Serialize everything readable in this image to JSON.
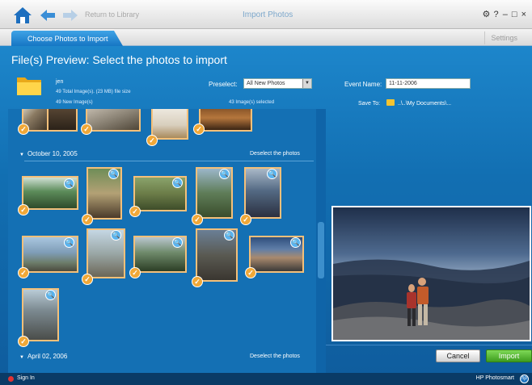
{
  "titlebar": {
    "return_label": "Return to Library",
    "title": "Import Photos",
    "controls": "⚙ ? – □ ×"
  },
  "tabs": {
    "active": "Choose Photos to Import",
    "settings": "Settings"
  },
  "page_title": "File(s) Preview: Select the photos to import",
  "source": {
    "name": "jen",
    "total": "49 Total Image(s). (23 MB) file size",
    "new_count": "49 New Image(s)",
    "selected": "43 Image(s) selected"
  },
  "preselect": {
    "label": "Preselect:",
    "value": "All New Photos"
  },
  "event": {
    "label": "Event Name:",
    "value": "11-11-2006"
  },
  "save_to": {
    "label": "Save To:",
    "path": "..\\..\\My Documents\\..."
  },
  "groups": [
    {
      "date": "October 10, 2005",
      "deselect": "Deselect the photos"
    },
    {
      "date": "April 02, 2006",
      "deselect": "Deselect the photos"
    }
  ],
  "icons": {
    "check": "✓",
    "zoom": "🔍"
  },
  "buttons": {
    "cancel": "Cancel",
    "import": "Import"
  },
  "status": {
    "signin": "Sign In",
    "brand": "HP Photosmart",
    "logo": "hp"
  },
  "colors": {
    "accent": "#1676c4",
    "selection_border": "#f4c07a",
    "import_green": "#4aab24"
  }
}
